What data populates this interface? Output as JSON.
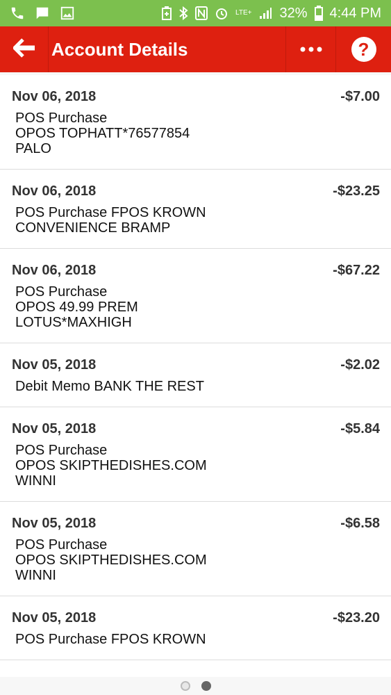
{
  "status_bar": {
    "battery": "32%",
    "time": "4:44 PM",
    "network": "LTE+",
    "left_icons": [
      "phone-icon",
      "message-icon",
      "image-icon"
    ],
    "right_icons": [
      "battery-saver-icon",
      "bluetooth-icon",
      "nfc-icon",
      "alarm-icon",
      "lte-icon",
      "signal-icon",
      "battery-icon"
    ]
  },
  "app_bar": {
    "title": "Account Details",
    "back_icon": "back-arrow-icon",
    "more_icon": "more-horizontal-icon",
    "help_label": "?",
    "color": "#de2010"
  },
  "transactions": [
    {
      "date": "Nov 06, 2018",
      "amount": "-$7.00",
      "description": "POS Purchase\nOPOS TOPHATT*76577854\nPALO"
    },
    {
      "date": "Nov 06, 2018",
      "amount": "-$23.25",
      "description": "POS Purchase FPOS KROWN\nCONVENIENCE   BRAMP"
    },
    {
      "date": "Nov 06, 2018",
      "amount": "-$67.22",
      "description": "POS Purchase\nOPOS 49.99 PREM\nLOTUS*MAXHIGH"
    },
    {
      "date": "Nov 05, 2018",
      "amount": "-$2.02",
      "description": "Debit Memo BANK THE REST"
    },
    {
      "date": "Nov 05, 2018",
      "amount": "-$5.84",
      "description": "POS Purchase\nOPOS SKIPTHEDISHES.COM\nWINNI"
    },
    {
      "date": "Nov 05, 2018",
      "amount": "-$6.58",
      "description": "POS Purchase\nOPOS SKIPTHEDISHES.COM\nWINNI"
    },
    {
      "date": "Nov 05, 2018",
      "amount": "-$23.20",
      "description": "POS Purchase FPOS KROWN"
    }
  ],
  "pager": {
    "pages": 2,
    "current": 2
  }
}
